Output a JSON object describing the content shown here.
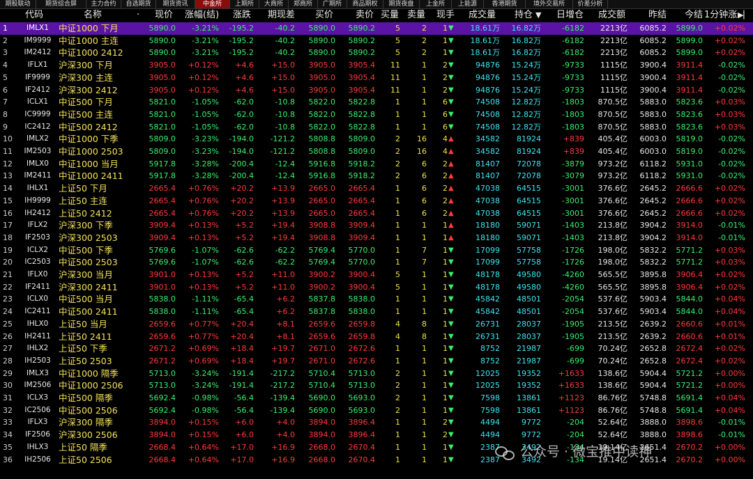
{
  "tabs": [
    "期股联动",
    "期货综合屏",
    "主力合约",
    "自选期货",
    "期货资讯",
    "中金所",
    "上期所",
    "大商所",
    "郑商所",
    "广期所",
    "商品期权",
    "期货夜盘",
    "上金所",
    "上能源",
    "香港期货",
    "境外交易所",
    "价差分析"
  ],
  "active_tab": "中金所",
  "header": {
    "idx": "",
    "code": "代码",
    "name": "名称",
    "dot": "·",
    "price": "现价",
    "pct": "涨幅(结)",
    "chg": "涨跌",
    "basis": "期现差",
    "bid": "买价",
    "ask": "卖价",
    "bidvol": "买量",
    "askvol": "卖量",
    "last": "现手",
    "vol": "成交量",
    "oi": "持仓",
    "oi_sort_icon": "arrow-down",
    "oichg": "日增仓",
    "amt": "成交额",
    "prev": "昨结",
    "today": "今结",
    "min1": "1分钟涨",
    "panel_icon": "expand-icon"
  },
  "colors": {
    "up": "#ff3b3b",
    "down": "#3cf06e",
    "name": "#f4e25a",
    "volume": "#40e6f2",
    "selected_row": "#5a13a5",
    "active_tab": "#8a0c0c"
  },
  "rows": [
    {
      "n": "1",
      "code": "IMLX1",
      "name": "中证1000 下月",
      "price": "5890.0",
      "pct": "-3.21%",
      "chg": "-195.2",
      "basis": "-40.2",
      "bid": "5890.0",
      "ask": "5890.2",
      "bv": "5",
      "av": "2",
      "lh": "1",
      "dir": "down",
      "vol": "18.61万",
      "oi": "16.82万",
      "oic": "-6182",
      "amt": "2213亿",
      "prev": "6085.2",
      "today": "5899.0",
      "m1": "+0.02%"
    },
    {
      "n": "2",
      "code": "IM9999",
      "name": "中证1000 主连",
      "price": "5890.0",
      "pct": "-3.21%",
      "chg": "-195.2",
      "basis": "-40.2",
      "bid": "5890.0",
      "ask": "5890.2",
      "bv": "5",
      "av": "2",
      "lh": "1",
      "dir": "down",
      "vol": "18.61万",
      "oi": "16.82万",
      "oic": "-6182",
      "amt": "2213亿",
      "prev": "6085.2",
      "today": "5899.0",
      "m1": "+0.02%"
    },
    {
      "n": "3",
      "code": "IM2412",
      "name": "中证1000 2412",
      "price": "5890.0",
      "pct": "-3.21%",
      "chg": "-195.2",
      "basis": "-40.2",
      "bid": "5890.0",
      "ask": "5890.2",
      "bv": "5",
      "av": "2",
      "lh": "1",
      "dir": "down",
      "vol": "18.61万",
      "oi": "16.82万",
      "oic": "-6182",
      "amt": "2213亿",
      "prev": "6085.2",
      "today": "5899.0",
      "m1": "+0.02%"
    },
    {
      "n": "4",
      "code": "IFLX1",
      "name": "沪深300 下月",
      "price": "3905.0",
      "pct": "+0.12%",
      "chg": "+4.6",
      "basis": "+15.0",
      "bid": "3905.0",
      "ask": "3905.4",
      "bv": "11",
      "av": "1",
      "lh": "2",
      "dir": "down",
      "vol": "94876",
      "oi": "15.24万",
      "oic": "-9733",
      "amt": "1115亿",
      "prev": "3900.4",
      "today": "3911.4",
      "m1": "-0.02%"
    },
    {
      "n": "5",
      "code": "IF9999",
      "name": "沪深300 主连",
      "price": "3905.0",
      "pct": "+0.12%",
      "chg": "+4.6",
      "basis": "+15.0",
      "bid": "3905.0",
      "ask": "3905.4",
      "bv": "11",
      "av": "1",
      "lh": "2",
      "dir": "down",
      "vol": "94876",
      "oi": "15.24万",
      "oic": "-9733",
      "amt": "1115亿",
      "prev": "3900.4",
      "today": "3911.4",
      "m1": "-0.02%"
    },
    {
      "n": "6",
      "code": "IF2412",
      "name": "沪深300 2412",
      "price": "3905.0",
      "pct": "+0.12%",
      "chg": "+4.6",
      "basis": "+15.0",
      "bid": "3905.0",
      "ask": "3905.4",
      "bv": "11",
      "av": "1",
      "lh": "2",
      "dir": "down",
      "vol": "94876",
      "oi": "15.24万",
      "oic": "-9733",
      "amt": "1115亿",
      "prev": "3900.4",
      "today": "3911.4",
      "m1": "-0.02%"
    },
    {
      "n": "7",
      "code": "ICLX1",
      "name": "中证500 下月",
      "price": "5821.0",
      "pct": "-1.05%",
      "chg": "-62.0",
      "basis": "-10.8",
      "bid": "5822.0",
      "ask": "5822.8",
      "bv": "1",
      "av": "1",
      "lh": "6",
      "dir": "down",
      "vol": "74508",
      "oi": "12.82万",
      "oic": "-1803",
      "amt": "870.5亿",
      "prev": "5883.0",
      "today": "5823.6",
      "m1": "+0.03%"
    },
    {
      "n": "8",
      "code": "IC9999",
      "name": "中证500 主连",
      "price": "5821.0",
      "pct": "-1.05%",
      "chg": "-62.0",
      "basis": "-10.8",
      "bid": "5822.0",
      "ask": "5822.8",
      "bv": "1",
      "av": "1",
      "lh": "6",
      "dir": "down",
      "vol": "74508",
      "oi": "12.82万",
      "oic": "-1803",
      "amt": "870.5亿",
      "prev": "5883.0",
      "today": "5823.6",
      "m1": "+0.03%"
    },
    {
      "n": "9",
      "code": "IC2412",
      "name": "中证500 2412",
      "price": "5821.0",
      "pct": "-1.05%",
      "chg": "-62.0",
      "basis": "-10.8",
      "bid": "5822.0",
      "ask": "5822.8",
      "bv": "1",
      "av": "1",
      "lh": "6",
      "dir": "down",
      "vol": "74508",
      "oi": "12.82万",
      "oic": "-1803",
      "amt": "870.5亿",
      "prev": "5883.0",
      "today": "5823.6",
      "m1": "+0.03%"
    },
    {
      "n": "10",
      "code": "IMLX2",
      "name": "中证1000 下季",
      "price": "5809.0",
      "pct": "-3.23%",
      "chg": "-194.0",
      "basis": "-121.2",
      "bid": "5808.8",
      "ask": "5809.0",
      "bv": "2",
      "av": "16",
      "lh": "4",
      "dir": "up",
      "vol": "34582",
      "oi": "81924",
      "oic": "+839",
      "amt": "405.4亿",
      "prev": "6003.0",
      "today": "5819.0",
      "m1": "-0.02%"
    },
    {
      "n": "11",
      "code": "IM2503",
      "name": "中证1000 2503",
      "price": "5809.0",
      "pct": "-3.23%",
      "chg": "-194.0",
      "basis": "-121.2",
      "bid": "5808.8",
      "ask": "5809.0",
      "bv": "2",
      "av": "16",
      "lh": "4",
      "dir": "up",
      "vol": "34582",
      "oi": "81924",
      "oic": "+839",
      "amt": "405.4亿",
      "prev": "6003.0",
      "today": "5819.0",
      "m1": "-0.02%"
    },
    {
      "n": "12",
      "code": "IMLX0",
      "name": "中证1000 当月",
      "price": "5917.8",
      "pct": "-3.28%",
      "chg": "-200.4",
      "basis": "-12.4",
      "bid": "5916.8",
      "ask": "5918.2",
      "bv": "2",
      "av": "6",
      "lh": "2",
      "dir": "up",
      "vol": "81407",
      "oi": "72078",
      "oic": "-3879",
      "amt": "973.2亿",
      "prev": "6118.2",
      "today": "5931.0",
      "m1": "-0.02%"
    },
    {
      "n": "13",
      "code": "IM2411",
      "name": "中证1000 2411",
      "price": "5917.8",
      "pct": "-3.28%",
      "chg": "-200.4",
      "basis": "-12.4",
      "bid": "5916.8",
      "ask": "5918.2",
      "bv": "2",
      "av": "6",
      "lh": "2",
      "dir": "up",
      "vol": "81407",
      "oi": "72078",
      "oic": "-3079",
      "amt": "973.2亿",
      "prev": "6118.2",
      "today": "5931.0",
      "m1": "-0.02%"
    },
    {
      "n": "14",
      "code": "IHLX1",
      "name": "上证50 下月",
      "price": "2665.4",
      "pct": "+0.76%",
      "chg": "+20.2",
      "basis": "+13.9",
      "bid": "2665.0",
      "ask": "2665.4",
      "bv": "1",
      "av": "6",
      "lh": "2",
      "dir": "up",
      "vol": "47038",
      "oi": "64515",
      "oic": "-3001",
      "amt": "376.6亿",
      "prev": "2645.2",
      "today": "2666.6",
      "m1": "+0.02%"
    },
    {
      "n": "15",
      "code": "IH9999",
      "name": "上证50 主连",
      "price": "2665.4",
      "pct": "+0.76%",
      "chg": "+20.2",
      "basis": "+13.9",
      "bid": "2665.0",
      "ask": "2665.4",
      "bv": "1",
      "av": "6",
      "lh": "2",
      "dir": "up",
      "vol": "47038",
      "oi": "64515",
      "oic": "-3001",
      "amt": "376.6亿",
      "prev": "2645.2",
      "today": "2666.6",
      "m1": "+0.02%"
    },
    {
      "n": "16",
      "code": "IH2412",
      "name": "上证50 2412",
      "price": "2665.4",
      "pct": "+0.76%",
      "chg": "+20.2",
      "basis": "+13.9",
      "bid": "2665.0",
      "ask": "2665.4",
      "bv": "1",
      "av": "6",
      "lh": "2",
      "dir": "up",
      "vol": "47038",
      "oi": "64515",
      "oic": "-3001",
      "amt": "376.6亿",
      "prev": "2645.2",
      "today": "2666.6",
      "m1": "+0.02%"
    },
    {
      "n": "17",
      "code": "IFLX2",
      "name": "沪深300 下季",
      "price": "3909.4",
      "pct": "+0.13%",
      "chg": "+5.2",
      "basis": "+19.4",
      "bid": "3908.8",
      "ask": "3909.4",
      "bv": "1",
      "av": "1",
      "lh": "1",
      "dir": "up",
      "vol": "18180",
      "oi": "59071",
      "oic": "-1403",
      "amt": "213.8亿",
      "prev": "3904.2",
      "today": "3914.0",
      "m1": "-0.01%"
    },
    {
      "n": "18",
      "code": "IF2503",
      "name": "沪深300 2503",
      "price": "3909.4",
      "pct": "+0.13%",
      "chg": "+5.2",
      "basis": "+19.4",
      "bid": "3908.8",
      "ask": "3909.4",
      "bv": "1",
      "av": "1",
      "lh": "1",
      "dir": "up",
      "vol": "18180",
      "oi": "59071",
      "oic": "-1403",
      "amt": "213.8亿",
      "prev": "3904.2",
      "today": "3914.0",
      "m1": "-0.01%"
    },
    {
      "n": "19",
      "code": "ICLX2",
      "name": "中证500 下季",
      "price": "5769.6",
      "pct": "-1.07%",
      "chg": "-62.6",
      "basis": "-62.2",
      "bid": "5769.4",
      "ask": "5770.0",
      "bv": "1",
      "av": "7",
      "lh": "1",
      "dir": "down",
      "vol": "17099",
      "oi": "57758",
      "oic": "-1726",
      "amt": "198.0亿",
      "prev": "5832.2",
      "today": "5771.2",
      "m1": "+0.03%"
    },
    {
      "n": "20",
      "code": "IC2503",
      "name": "中证500 2503",
      "price": "5769.6",
      "pct": "-1.07%",
      "chg": "-62.6",
      "basis": "-62.2",
      "bid": "5769.4",
      "ask": "5770.0",
      "bv": "1",
      "av": "7",
      "lh": "1",
      "dir": "down",
      "vol": "17099",
      "oi": "57758",
      "oic": "-1726",
      "amt": "198.0亿",
      "prev": "5832.2",
      "today": "5771.2",
      "m1": "+0.03%"
    },
    {
      "n": "21",
      "code": "IFLX0",
      "name": "沪深300 当月",
      "price": "3901.0",
      "pct": "+0.13%",
      "chg": "+5.2",
      "basis": "+11.0",
      "bid": "3900.2",
      "ask": "3900.4",
      "bv": "5",
      "av": "1",
      "lh": "1",
      "dir": "down",
      "vol": "48178",
      "oi": "49580",
      "oic": "-4260",
      "amt": "565.5亿",
      "prev": "3895.8",
      "today": "3906.4",
      "m1": "+0.02%"
    },
    {
      "n": "22",
      "code": "IF2411",
      "name": "沪深300 2411",
      "price": "3901.0",
      "pct": "+0.13%",
      "chg": "+5.2",
      "basis": "+11.0",
      "bid": "3900.2",
      "ask": "3900.4",
      "bv": "5",
      "av": "1",
      "lh": "1",
      "dir": "down",
      "vol": "48178",
      "oi": "49580",
      "oic": "-4260",
      "amt": "565.5亿",
      "prev": "3895.8",
      "today": "3906.4",
      "m1": "+0.02%"
    },
    {
      "n": "23",
      "code": "ICLX0",
      "name": "中证500 当月",
      "price": "5838.0",
      "pct": "-1.11%",
      "chg": "-65.4",
      "basis": "+6.2",
      "bid": "5837.8",
      "ask": "5838.0",
      "bv": "1",
      "av": "1",
      "lh": "1",
      "dir": "down",
      "vol": "45842",
      "oi": "48501",
      "oic": "-2054",
      "amt": "537.6亿",
      "prev": "5903.4",
      "today": "5844.0",
      "m1": "+0.04%"
    },
    {
      "n": "24",
      "code": "IC2411",
      "name": "中证500 2411",
      "price": "5838.0",
      "pct": "-1.11%",
      "chg": "-65.4",
      "basis": "+6.2",
      "bid": "5837.8",
      "ask": "5838.0",
      "bv": "1",
      "av": "1",
      "lh": "1",
      "dir": "down",
      "vol": "45842",
      "oi": "48501",
      "oic": "-2054",
      "amt": "537.6亿",
      "prev": "5903.4",
      "today": "5844.0",
      "m1": "+0.04%"
    },
    {
      "n": "25",
      "code": "IHLX0",
      "name": "上证50 当月",
      "price": "2659.6",
      "pct": "+0.77%",
      "chg": "+20.4",
      "basis": "+8.1",
      "bid": "2659.6",
      "ask": "2659.8",
      "bv": "4",
      "av": "8",
      "lh": "1",
      "dir": "down",
      "vol": "26731",
      "oi": "28037",
      "oic": "-1905",
      "amt": "213.5亿",
      "prev": "2639.2",
      "today": "2660.6",
      "m1": "+0.01%"
    },
    {
      "n": "26",
      "code": "IH2411",
      "name": "上证50 2411",
      "price": "2659.6",
      "pct": "+0.77%",
      "chg": "+20.4",
      "basis": "+8.1",
      "bid": "2659.6",
      "ask": "2659.8",
      "bv": "4",
      "av": "8",
      "lh": "1",
      "dir": "down",
      "vol": "26731",
      "oi": "28037",
      "oic": "-1905",
      "amt": "213.5亿",
      "prev": "2639.2",
      "today": "2660.6",
      "m1": "+0.01%"
    },
    {
      "n": "27",
      "code": "IHLX2",
      "name": "上证50 下季",
      "price": "2671.2",
      "pct": "+0.69%",
      "chg": "+18.4",
      "basis": "+19.7",
      "bid": "2671.0",
      "ask": "2672.6",
      "bv": "1",
      "av": "1",
      "lh": "1",
      "dir": "down",
      "vol": "8752",
      "oi": "21987",
      "oic": "-699",
      "amt": "70.24亿",
      "prev": "2652.8",
      "today": "2672.4",
      "m1": "+0.02%"
    },
    {
      "n": "28",
      "code": "IH2503",
      "name": "上证50 2503",
      "price": "2671.2",
      "pct": "+0.69%",
      "chg": "+18.4",
      "basis": "+19.7",
      "bid": "2671.0",
      "ask": "2672.6",
      "bv": "1",
      "av": "1",
      "lh": "1",
      "dir": "down",
      "vol": "8752",
      "oi": "21987",
      "oic": "-699",
      "amt": "70.24亿",
      "prev": "2652.8",
      "today": "2672.4",
      "m1": "+0.02%"
    },
    {
      "n": "29",
      "code": "IMLX3",
      "name": "中证1000 隔季",
      "price": "5713.0",
      "pct": "-3.24%",
      "chg": "-191.4",
      "basis": "-217.2",
      "bid": "5710.4",
      "ask": "5713.0",
      "bv": "2",
      "av": "1",
      "lh": "1",
      "dir": "down",
      "vol": "12025",
      "oi": "19352",
      "oic": "+1633",
      "amt": "138.6亿",
      "prev": "5904.4",
      "today": "5721.2",
      "m1": "+0.00%"
    },
    {
      "n": "30",
      "code": "IM2506",
      "name": "中证1000 2506",
      "price": "5713.0",
      "pct": "-3.24%",
      "chg": "-191.4",
      "basis": "-217.2",
      "bid": "5710.4",
      "ask": "5713.0",
      "bv": "2",
      "av": "1",
      "lh": "1",
      "dir": "down",
      "vol": "12025",
      "oi": "19352",
      "oic": "+1633",
      "amt": "138.6亿",
      "prev": "5904.4",
      "today": "5721.2",
      "m1": "+0.00%"
    },
    {
      "n": "31",
      "code": "ICLX3",
      "name": "中证500 隔季",
      "price": "5692.4",
      "pct": "-0.98%",
      "chg": "-56.4",
      "basis": "-139.4",
      "bid": "5690.0",
      "ask": "5693.0",
      "bv": "2",
      "av": "1",
      "lh": "1",
      "dir": "down",
      "vol": "7598",
      "oi": "13861",
      "oic": "+1123",
      "amt": "86.76亿",
      "prev": "5748.8",
      "today": "5691.4",
      "m1": "+0.04%"
    },
    {
      "n": "32",
      "code": "IC2506",
      "name": "中证500 2506",
      "price": "5692.4",
      "pct": "-0.98%",
      "chg": "-56.4",
      "basis": "-139.4",
      "bid": "5690.0",
      "ask": "5693.0",
      "bv": "2",
      "av": "1",
      "lh": "1",
      "dir": "down",
      "vol": "7598",
      "oi": "13861",
      "oic": "+1123",
      "amt": "86.76亿",
      "prev": "5748.8",
      "today": "5691.4",
      "m1": "+0.04%"
    },
    {
      "n": "33",
      "code": "IFLX3",
      "name": "沪深300 隔季",
      "price": "3894.0",
      "pct": "+0.15%",
      "chg": "+6.0",
      "basis": "+4.0",
      "bid": "3894.0",
      "ask": "3896.4",
      "bv": "1",
      "av": "1",
      "lh": "2",
      "dir": "down",
      "vol": "4494",
      "oi": "9772",
      "oic": "-204",
      "amt": "52.64亿",
      "prev": "3888.0",
      "today": "3898.6",
      "m1": "-0.01%"
    },
    {
      "n": "34",
      "code": "IF2506",
      "name": "沪深300 2506",
      "price": "3894.0",
      "pct": "+0.15%",
      "chg": "+6.0",
      "basis": "+4.0",
      "bid": "3894.0",
      "ask": "3896.4",
      "bv": "1",
      "av": "1",
      "lh": "2",
      "dir": "down",
      "vol": "4494",
      "oi": "9772",
      "oic": "-204",
      "amt": "52.64亿",
      "prev": "3888.0",
      "today": "3898.6",
      "m1": "-0.01%"
    },
    {
      "n": "35",
      "code": "IHLX3",
      "name": "上证50 隔季",
      "price": "2668.4",
      "pct": "+0.64%",
      "chg": "+17.0",
      "basis": "+16.9",
      "bid": "2668.0",
      "ask": "2670.4",
      "bv": "1",
      "av": "1",
      "lh": "1",
      "dir": "down",
      "vol": "2387",
      "oi": "3492",
      "oic": "-134",
      "amt": "19.14亿",
      "prev": "2651.4",
      "today": "2670.2",
      "m1": "+0.00%"
    },
    {
      "n": "36",
      "code": "IH2506",
      "name": "上证50 2506",
      "price": "2668.4",
      "pct": "+0.64%",
      "chg": "+17.0",
      "basis": "+16.9",
      "bid": "2668.0",
      "ask": "2670.4",
      "bv": "1",
      "av": "1",
      "lh": "1",
      "dir": "down",
      "vol": "2387",
      "oi": "3492",
      "oic": "-134",
      "amt": "19.14亿",
      "prev": "2651.4",
      "today": "2670.2",
      "m1": "+0.00%"
    }
  ],
  "watermark": "公众号 · 微宝推中读神"
}
